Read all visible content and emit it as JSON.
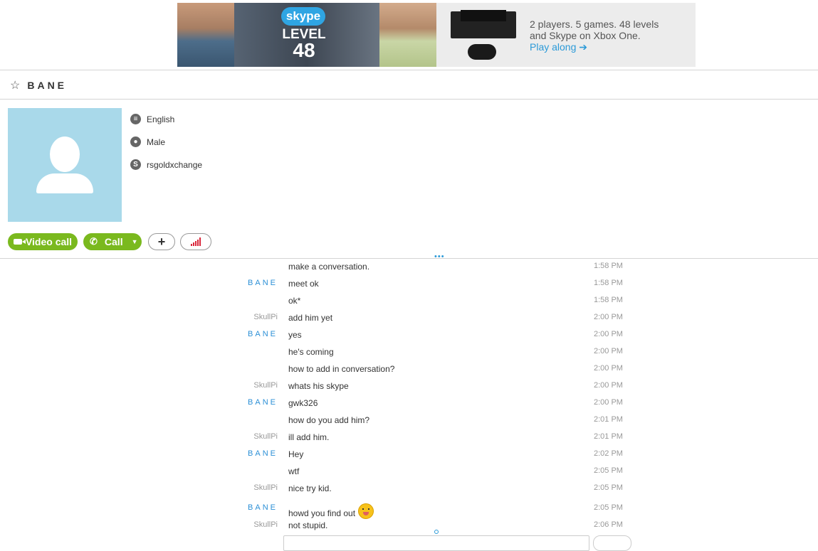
{
  "banner": {
    "logo_text": "skype",
    "level_text": "LEVEL",
    "level_number": "48",
    "ad_line1": "2 players. 5 games. 48 levels",
    "ad_line2": "and Skype on Xbox One.",
    "ad_link": "Play along ➔"
  },
  "contact": {
    "name": "BANE",
    "language": "English",
    "gender": "Male",
    "skype_name": "rsgoldxchange"
  },
  "actions": {
    "video_call_label": "Video call",
    "call_label": "Call"
  },
  "icons": {
    "star": "star-icon",
    "language": "speech-bubble-icon",
    "gender": "person-icon",
    "skype": "skype-icon",
    "video": "camera-icon",
    "phone": "phone-icon",
    "add": "plus-icon",
    "signal": "call-quality-icon",
    "emoji": "tongue-out-emoji-icon"
  },
  "colors": {
    "accent_green": "#7ab91e",
    "link_blue": "#2b8fd6",
    "avatar_bg": "#a9d9ea",
    "signal_red": "#d9263a"
  },
  "messages": [
    {
      "sender": "",
      "text": "make a conversation.",
      "time": "1:58 PM"
    },
    {
      "sender": "BANE",
      "text": "meet ok",
      "time": "1:58 PM"
    },
    {
      "sender": "",
      "text": "ok*",
      "time": "1:58 PM"
    },
    {
      "sender": "SkullPi",
      "text": "add him yet",
      "time": "2:00 PM"
    },
    {
      "sender": "BANE",
      "text": "yes",
      "time": "2:00 PM"
    },
    {
      "sender": "",
      "text": "he's coming",
      "time": "2:00 PM"
    },
    {
      "sender": "",
      "text": "how to add in conversation?",
      "time": "2:00 PM"
    },
    {
      "sender": "SkullPi",
      "text": "whats his skype",
      "time": "2:00 PM"
    },
    {
      "sender": "BANE",
      "text": "gwk326",
      "time": "2:00 PM"
    },
    {
      "sender": "",
      "text": "how do you add him?",
      "time": "2:01 PM"
    },
    {
      "sender": "SkullPi",
      "text": "ill add him.",
      "time": "2:01 PM"
    },
    {
      "sender": "BANE",
      "text": "Hey",
      "time": "2:02 PM"
    },
    {
      "sender": "",
      "text": "wtf",
      "time": "2:05 PM"
    },
    {
      "sender": "SkullPi",
      "text": "nice try kid.",
      "time": "2:05 PM"
    },
    {
      "sender": "BANE",
      "text": "howd you find out",
      "time": "2:05 PM"
    },
    {
      "sender": "SkullPi",
      "text": "not stupid.",
      "time": "2:06 PM"
    }
  ]
}
